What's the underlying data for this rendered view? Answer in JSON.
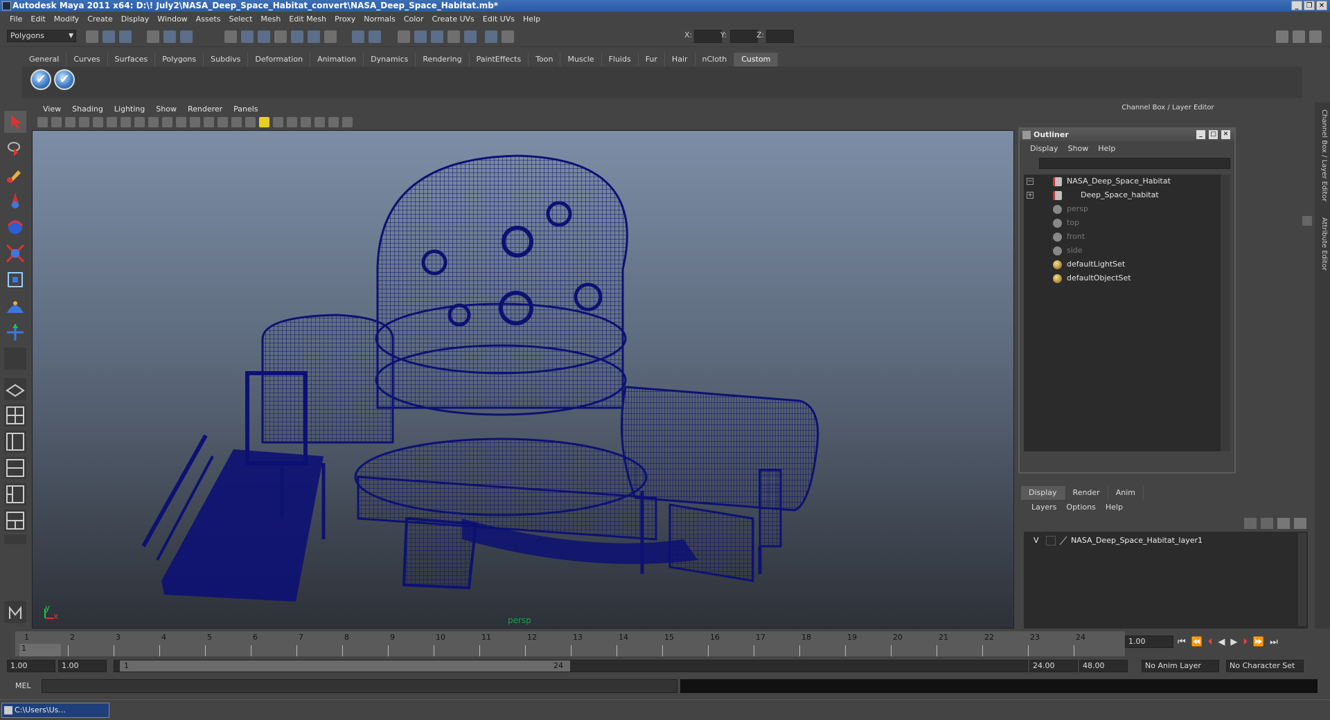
{
  "window": {
    "title": "Autodesk Maya 2011 x64: D:\\! July2\\NASA_Deep_Space_Habitat_convert\\NASA_Deep_Space_Habitat.mb*"
  },
  "menubar": [
    "File",
    "Edit",
    "Modify",
    "Create",
    "Display",
    "Window",
    "Assets",
    "Select",
    "Mesh",
    "Edit Mesh",
    "Proxy",
    "Normals",
    "Color",
    "Create UVs",
    "Edit UVs",
    "Help"
  ],
  "status": {
    "mode": "Polygons",
    "x_label": "X:",
    "y_label": "Y:",
    "z_label": "Z:"
  },
  "shelf": {
    "tabs": [
      "General",
      "Curves",
      "Surfaces",
      "Polygons",
      "Subdivs",
      "Deformation",
      "Animation",
      "Dynamics",
      "Rendering",
      "PaintEffects",
      "Toon",
      "Muscle",
      "Fluids",
      "Fur",
      "Hair",
      "nCloth",
      "Custom"
    ],
    "active": "Custom"
  },
  "viewport": {
    "menu": [
      "View",
      "Shading",
      "Lighting",
      "Show",
      "Renderer",
      "Panels"
    ],
    "camera_label": "persp",
    "axis_y": "y",
    "axis_x": "x",
    "wire_color": "#0d1173"
  },
  "right_panel": {
    "title": "Channel Box / Layer Editor",
    "side_tabs": [
      "Channel Box / Layer Editor",
      "Attribute Editor"
    ]
  },
  "outliner": {
    "title": "Outliner",
    "menu": [
      "Display",
      "Show",
      "Help"
    ],
    "items": [
      {
        "label": "NASA_Deep_Space_Habitat",
        "kind": "transform",
        "expander": "minus"
      },
      {
        "label": "Deep_Space_habitat",
        "kind": "transform",
        "expander": "plus"
      },
      {
        "label": "persp",
        "kind": "camera"
      },
      {
        "label": "top",
        "kind": "camera"
      },
      {
        "label": "front",
        "kind": "camera"
      },
      {
        "label": "side",
        "kind": "camera"
      },
      {
        "label": "defaultLightSet",
        "kind": "set"
      },
      {
        "label": "defaultObjectSet",
        "kind": "set"
      }
    ]
  },
  "layer_editor": {
    "tabs": [
      "Display",
      "Render",
      "Anim"
    ],
    "active": "Display",
    "menu": [
      "Layers",
      "Options",
      "Help"
    ],
    "layers": [
      {
        "visible": "V",
        "name": "NASA_Deep_Space_Habitat_layer1"
      }
    ]
  },
  "timeline": {
    "frames": [
      "1",
      "2",
      "3",
      "4",
      "5",
      "6",
      "7",
      "8",
      "9",
      "10",
      "11",
      "12",
      "13",
      "14",
      "15",
      "16",
      "17",
      "18",
      "19",
      "20",
      "21",
      "22",
      "23",
      "24"
    ],
    "current_marker": "1",
    "current_frame": "1.00"
  },
  "range": {
    "start": "1.00",
    "playback_start": "1.00",
    "slider_start": "1",
    "slider_end": "24",
    "playback_end": "24.00",
    "end": "48.00",
    "anim_layer": "No Anim Layer",
    "character_set": "No Character Set"
  },
  "command": {
    "label": "MEL"
  },
  "taskbar": {
    "item": "C:\\Users\\Us..."
  }
}
